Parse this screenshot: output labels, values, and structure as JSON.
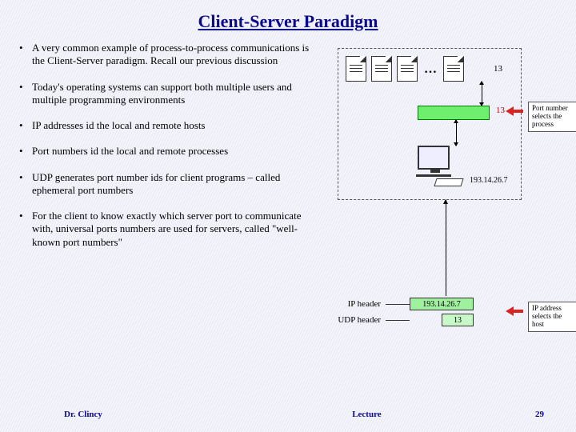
{
  "title": "Client-Server Paradigm",
  "bullets": [
    "A very common example of process-to-process communications is the Client-Server paradigm.  Recall our previous discussion",
    "Today's operating systems can support both multiple users and multiple programming environments",
    "IP addresses id the local and remote hosts",
    "Port numbers id the local and remote processes",
    "UDP generates port number ids for client programs – called ephemeral port numbers",
    "For the client to know exactly which server port to communicate with, universal ports numbers are used for servers, called \"well-known port numbers\""
  ],
  "diagram": {
    "processes_ellipsis": "…",
    "port_value": "13",
    "port_label_top": "13",
    "host_ip": "193.14.26.7",
    "ip_header_label": "IP header",
    "udp_header_label": "UDP header",
    "ip_header_value": "193.14.26.7",
    "udp_header_value": "13",
    "callout_port": "Port number selects the process",
    "callout_ip": "IP address selects the host"
  },
  "footer": {
    "author": "Dr. Clincy",
    "center": "Lecture",
    "page": "29"
  }
}
